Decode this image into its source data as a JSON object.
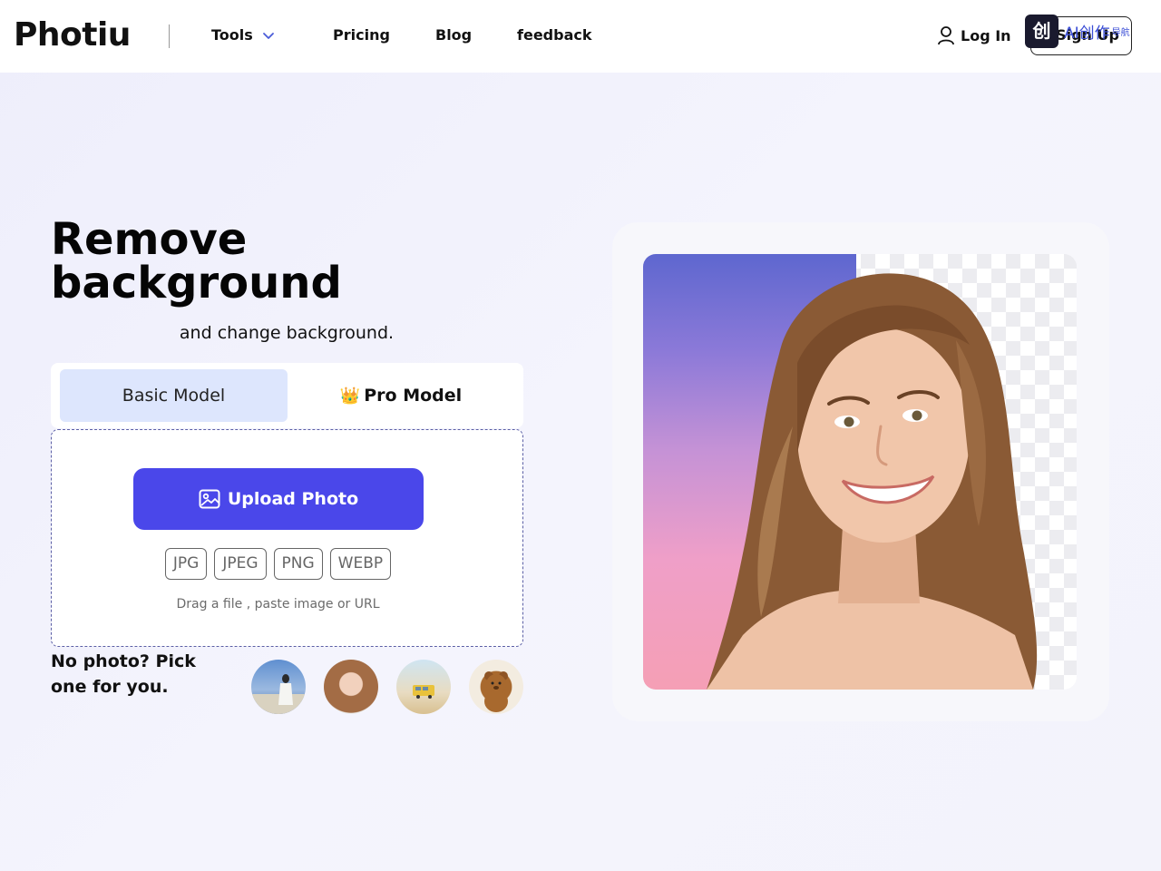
{
  "header": {
    "logo": "Photiu",
    "nav": {
      "tools": "Tools",
      "pricing": "Pricing",
      "blog": "Blog",
      "feedback": "feedback"
    },
    "login": "Log In",
    "signup": "Sign Up",
    "watermark": {
      "glyph": "创",
      "text": "AI创作",
      "sub": "导航"
    }
  },
  "hero": {
    "title": "Remove background",
    "subtitle": "and change background.",
    "tabs": {
      "basic": "Basic Model",
      "pro": "Pro Model",
      "pro_icon": "crown-icon"
    },
    "upload": {
      "button_label": "Upload Photo",
      "button_icon": "image-icon",
      "formats": [
        "JPG",
        "JPEG",
        "PNG",
        "WEBP"
      ],
      "hint": "Drag a file , paste image or URL"
    },
    "samples": {
      "prompt": "No photo? Pick one for you."
    }
  },
  "colors": {
    "accent": "#4a47ea",
    "tab_active": "#dde6fd",
    "background": "#f1f1fb"
  }
}
